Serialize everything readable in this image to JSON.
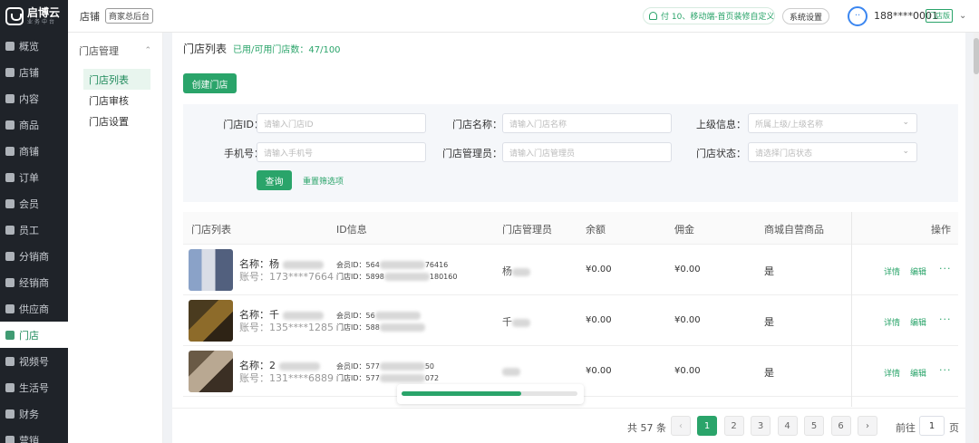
{
  "brand": {
    "name": "启博云",
    "sub": "业务中台"
  },
  "nav": [
    {
      "label": "概览",
      "icon": "dashboard-icon"
    },
    {
      "label": "店铺",
      "icon": "home-icon"
    },
    {
      "label": "内容",
      "icon": "layers-icon"
    },
    {
      "label": "商品",
      "icon": "box-icon"
    },
    {
      "label": "商铺",
      "icon": "heart-icon"
    },
    {
      "label": "订单",
      "icon": "order-icon"
    },
    {
      "label": "会员",
      "icon": "user-icon"
    },
    {
      "label": "员工",
      "icon": "staff-icon"
    },
    {
      "label": "分销商",
      "icon": "distribution-icon"
    },
    {
      "label": "经销商",
      "icon": "dealer-icon"
    },
    {
      "label": "供应商",
      "icon": "supplier-icon"
    },
    {
      "label": "门店",
      "icon": "store-icon",
      "active": true
    },
    {
      "label": "视频号",
      "icon": "video-icon"
    },
    {
      "label": "生活号",
      "icon": "life-icon"
    },
    {
      "label": "财务",
      "icon": "finance-icon"
    },
    {
      "label": "营销",
      "icon": "marketing-icon"
    }
  ],
  "header": {
    "store_label": "店铺",
    "hq_button": "商家总后台",
    "notice": "付 10、移动端-首页装修自定义",
    "settings": "系统设置",
    "phone": "188****0001",
    "store_tag": "门店版"
  },
  "submenu": {
    "title": "门店管理",
    "items": [
      "门店列表",
      "门店审核",
      "门店设置"
    ]
  },
  "page": {
    "title": "门店列表",
    "count_text": "已用/可用门店数：47/100",
    "create_button": "创建门店"
  },
  "filters": {
    "store_id": {
      "label": "门店ID：",
      "placeholder": "请输入门店ID"
    },
    "store_name": {
      "label": "门店名称：",
      "placeholder": "请输入门店名称"
    },
    "parent": {
      "label": "上级信息：",
      "placeholder": "所属上级/上级名称"
    },
    "phone": {
      "label": "手机号：",
      "placeholder": "请输入手机号"
    },
    "manager": {
      "label": "门店管理员：",
      "placeholder": "请输入门店管理员"
    },
    "status": {
      "label": "门店状态：",
      "placeholder": "请选择门店状态"
    },
    "query_button": "查询",
    "reset_link": "重置筛选项"
  },
  "table": {
    "columns": [
      "门店列表",
      "ID信息",
      "门店管理员",
      "余额",
      "佣金",
      "商城自营商品",
      "操作"
    ],
    "rows": [
      {
        "name_label": "名称：",
        "name": "杨",
        "account": "账号：173****7664",
        "member_id_label": "会员ID：",
        "member_id": "564",
        "member_id_end": "76416",
        "store_id_label": "门店ID：",
        "store_id": "5898",
        "store_id_end": "180160",
        "manager": "杨",
        "balance": "¥0.00",
        "commission": "¥0.00",
        "self_goods": "是"
      },
      {
        "name_label": "名称：",
        "name": "千",
        "account": "账号：135****1285",
        "member_id_label": "会员ID：",
        "member_id": "56",
        "member_id_end": "",
        "store_id_label": "门店ID：",
        "store_id": "588",
        "store_id_end": "",
        "manager": "千",
        "balance": "¥0.00",
        "commission": "¥0.00",
        "self_goods": "是"
      },
      {
        "name_label": "名称：",
        "name": "2",
        "account": "账号：131****6889",
        "member_id_label": "会员ID：",
        "member_id": "577",
        "member_id_end": "50",
        "store_id_label": "门店ID：",
        "store_id": "577",
        "store_id_end": "072",
        "manager": "",
        "balance": "¥0.00",
        "commission": "¥0.00",
        "self_goods": "是"
      }
    ],
    "actions": {
      "detail": "详情",
      "edit": "编辑",
      "more": "···"
    }
  },
  "progress": {
    "fraction": 0.68
  },
  "pagination": {
    "total": "共 57 条",
    "prev": "‹",
    "next": "›",
    "pages": [
      "1",
      "2",
      "3",
      "4",
      "5",
      "6"
    ],
    "current": "1",
    "goto_label": "前往",
    "goto_value": "1",
    "goto_suffix": "页"
  }
}
